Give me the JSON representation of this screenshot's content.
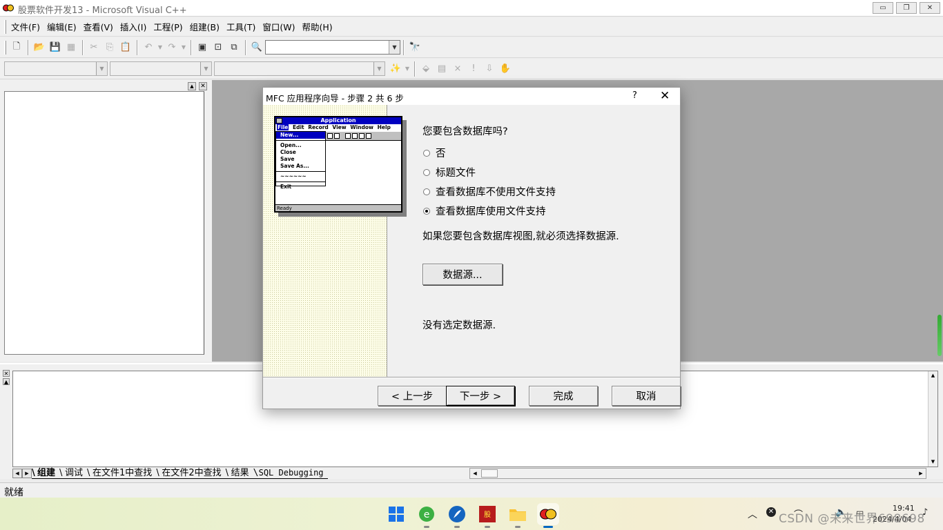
{
  "window": {
    "title": "股票软件开发13 - Microsoft Visual C++",
    "min_glyph": "▭",
    "restore_glyph": "❐",
    "close_glyph": "✕"
  },
  "menu": [
    "文件(F)",
    "编辑(E)",
    "查看(V)",
    "插入(I)",
    "工程(P)",
    "组建(B)",
    "工具(T)",
    "窗口(W)",
    "帮助(H)"
  ],
  "toolbar1": {
    "icons": [
      "new-text-file-icon",
      "open-folder-icon",
      "save-icon",
      "save-all-icon",
      "cut-icon",
      "copy-icon",
      "paste-icon",
      "undo-icon",
      "redo-icon",
      "workspace-icon",
      "output-window-icon",
      "window-list-icon",
      "find-in-files-icon",
      "find-icon"
    ],
    "search_value": ""
  },
  "toolbar2": {
    "combo1": "",
    "combo2": "",
    "combo3": ""
  },
  "dialog": {
    "title": "MFC 应用程序向导 - 步骤 2 共 6 步",
    "help_glyph": "?",
    "close_glyph": "✕",
    "question": "您要包含数据库吗?",
    "options": [
      {
        "label": "否",
        "checked": false
      },
      {
        "label": "标题文件",
        "checked": false
      },
      {
        "label": "查看数据库不使用文件支持",
        "checked": false
      },
      {
        "label": "查看数据库使用文件支持",
        "checked": true
      }
    ],
    "info": "如果您要包含数据库视图,就必须选择数据源.",
    "datasource_button": "数据源...",
    "no_datasource": "没有选定数据源.",
    "buttons": {
      "back": "< 上一步",
      "next": "下一步 >",
      "finish": "完成",
      "cancel": "取消"
    },
    "preview": {
      "title": "Application",
      "menu": [
        "File",
        "Edit",
        "Record",
        "View",
        "Window",
        "Help"
      ],
      "file_items": [
        "New...",
        "Open...",
        "Close",
        "Save",
        "Save As...",
        "~~~~~~",
        "Exit"
      ],
      "status": "Ready"
    }
  },
  "output_tabs": [
    "组建",
    "调试",
    "在文件1中查找",
    "在文件2中查找",
    "结果",
    "SQL Debugging"
  ],
  "status": "就绪",
  "taskbar": {
    "apps": [
      "windows-start-icon",
      "browser-icon",
      "feather-app-icon",
      "stock-app-icon",
      "file-explorer-icon",
      "visual-cpp-icon"
    ],
    "time": "19:41",
    "date": "2024/4/04"
  },
  "watermark": "CSDN @未来世界698698",
  "colors": {
    "preview_blue": "#0000c0",
    "taskbar_accent": "#0067c0"
  }
}
